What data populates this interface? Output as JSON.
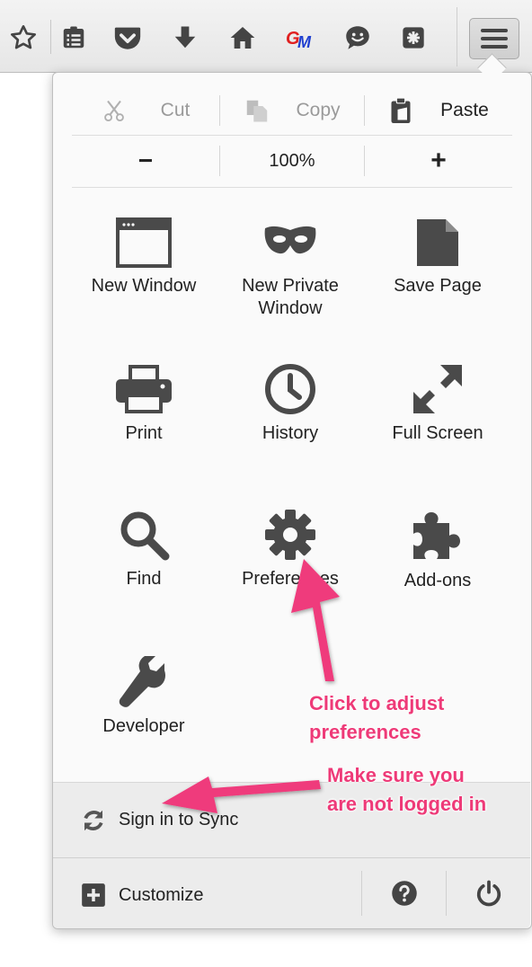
{
  "edit": {
    "cut": "Cut",
    "copy": "Copy",
    "paste": "Paste"
  },
  "zoom": {
    "minus": "−",
    "level": "100%",
    "plus": "+"
  },
  "grid": {
    "new_window": "New Window",
    "new_private_line1": "New Private",
    "new_private_line2": "Window",
    "save_page": "Save Page",
    "print": "Print",
    "history": "History",
    "full_screen": "Full Screen",
    "find": "Find",
    "preferences": "Preferences",
    "addons": "Add-ons",
    "developer": "Developer"
  },
  "footer": {
    "sync": "Sign in to Sync",
    "customize": "Customize"
  },
  "annotations": {
    "prefs_line1": "Click to adjust",
    "prefs_line2": "preferences",
    "sync_line1": "Make sure you",
    "sync_line2": "are not logged in"
  },
  "icons": {
    "toolbar": [
      "star-icon",
      "reading-list-icon",
      "pocket-icon",
      "download-icon",
      "home-icon",
      "gm-extension-icon",
      "chat-icon",
      "puzzle-box-icon",
      "menu-icon"
    ]
  },
  "colors": {
    "annotation": "#ee3a78",
    "icon": "#4a4a4a"
  }
}
